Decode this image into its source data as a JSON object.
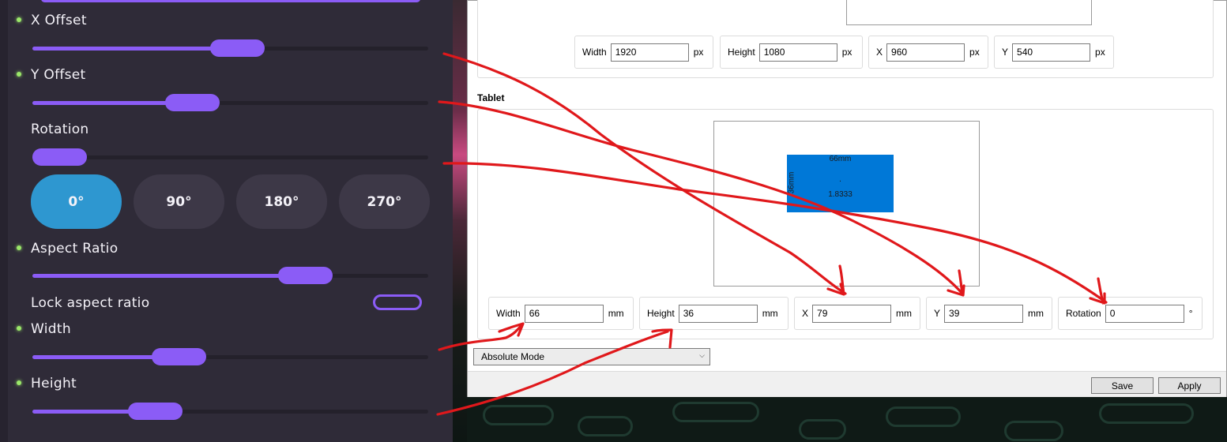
{
  "left_panel": {
    "x_offset": {
      "label": "X Offset",
      "value": 0.52
    },
    "y_offset": {
      "label": "Y Offset",
      "value": 0.39
    },
    "rotation": {
      "label": "Rotation",
      "value": 0.0,
      "buttons": [
        {
          "label": "0°",
          "active": true
        },
        {
          "label": "90°"
        },
        {
          "label": "180°"
        },
        {
          "label": "270°"
        }
      ]
    },
    "aspect_ratio": {
      "label": "Aspect Ratio",
      "value": 0.72
    },
    "lock_aspect_ratio": {
      "label": "Lock aspect ratio",
      "checked": false
    },
    "width": {
      "label": "Width",
      "value": 0.35
    },
    "height": {
      "label": "Height",
      "value": 0.28
    },
    "accent_color": "#8b5cf6",
    "active_button_color": "#2e97d0",
    "status_dot_color": "#9be86a"
  },
  "display": {
    "width": {
      "label": "Width",
      "value": "1920",
      "unit": "px"
    },
    "height": {
      "label": "Height",
      "value": "1080",
      "unit": "px"
    },
    "x": {
      "label": "X",
      "value": "960",
      "unit": "px"
    },
    "y": {
      "label": "Y",
      "value": "540",
      "unit": "px"
    }
  },
  "tablet": {
    "section_title": "Tablet",
    "area": {
      "width_label": "66mm",
      "height_label": "36mm",
      "center_mark": ".",
      "ratio_label": "1.8333",
      "color": "#0078d7"
    },
    "width": {
      "label": "Width",
      "value": "66",
      "unit": "mm"
    },
    "height": {
      "label": "Height",
      "value": "36",
      "unit": "mm"
    },
    "x": {
      "label": "X",
      "value": "79",
      "unit": "mm"
    },
    "y": {
      "label": "Y",
      "value": "39",
      "unit": "mm"
    },
    "rotation": {
      "label": "Rotation",
      "value": "0",
      "unit": "°"
    }
  },
  "mode_select": {
    "value": "Absolute Mode",
    "chevron_icon": "chevron-down-icon"
  },
  "buttons": {
    "save": "Save",
    "apply": "Apply"
  },
  "annotation_color": "#e0181b"
}
